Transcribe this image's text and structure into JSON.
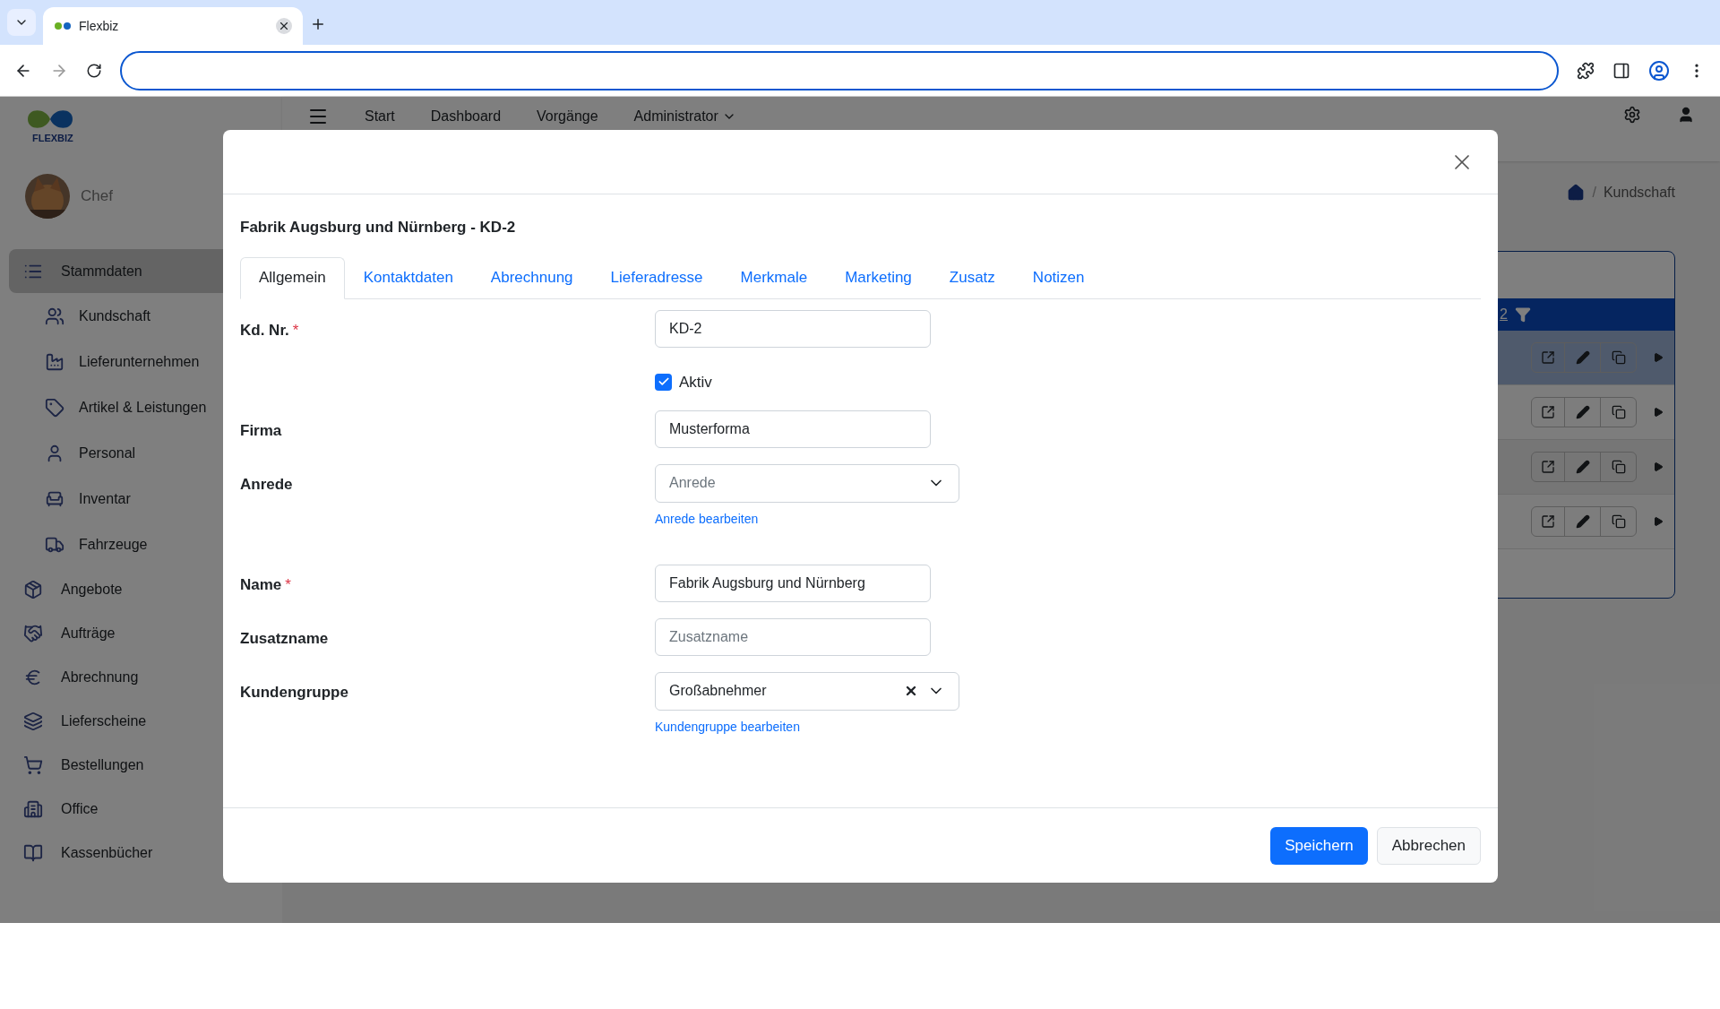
{
  "browser": {
    "tab_title": "Flexbiz"
  },
  "app": {
    "logo_text": "FLEXBIZ",
    "user": "Chef",
    "sidebar": [
      {
        "label": "Stammdaten",
        "selected": true,
        "children": [
          {
            "label": "Kundschaft"
          },
          {
            "label": "Lieferunternehmen"
          },
          {
            "label": "Artikel & Leistungen"
          },
          {
            "label": "Personal"
          },
          {
            "label": "Inventar"
          },
          {
            "label": "Fahrzeuge"
          }
        ]
      },
      {
        "label": "Angebote",
        "selected": false
      },
      {
        "label": "Aufträge",
        "selected": false
      },
      {
        "label": "Abrechnung",
        "selected": false
      },
      {
        "label": "Lieferscheine",
        "selected": false
      },
      {
        "label": "Bestellungen",
        "selected": false
      },
      {
        "label": "Office",
        "selected": false
      },
      {
        "label": "Kassenbücher",
        "selected": false
      }
    ],
    "nav": [
      {
        "label": "Start",
        "dropdown": false
      },
      {
        "label": "Dashboard",
        "dropdown": false
      },
      {
        "label": "Vorgänge",
        "dropdown": false
      },
      {
        "label": "Administrator",
        "dropdown": true
      }
    ],
    "breadcrumb": [
      {
        "separator": "/",
        "label": "Kundschaft"
      }
    ],
    "table": {
      "header_text": "2",
      "rows": [
        {
          "selected": true
        },
        {
          "selected": false
        },
        {
          "selected": false
        },
        {
          "selected": false
        }
      ]
    }
  },
  "modal": {
    "title": "Fabrik Augsburg und Nürnberg - KD-2",
    "tabs": [
      {
        "label": "Allgemein",
        "selected": true
      },
      {
        "label": "Kontaktdaten",
        "selected": false
      },
      {
        "label": "Abrechnung",
        "selected": false
      },
      {
        "label": "Lieferadresse",
        "selected": false
      },
      {
        "label": "Merkmale",
        "selected": false
      },
      {
        "label": "Marketing",
        "selected": false
      },
      {
        "label": "Zusatz",
        "selected": false
      },
      {
        "label": "Notizen",
        "selected": false
      }
    ],
    "fields": [
      {
        "kind": "text",
        "label": "Kd. Nr.",
        "required_mark": "*",
        "value": "KD-2"
      },
      {
        "kind": "checkbox",
        "label": "Aktiv",
        "checked": true
      },
      {
        "kind": "text",
        "label": "Firma",
        "value": "Musterforma"
      },
      {
        "kind": "select",
        "label": "Anrede",
        "placeholder": "Anrede",
        "clearable": false,
        "link": "Anrede bearbeiten"
      },
      {
        "kind": "text",
        "label": "Name",
        "required_mark": "*",
        "value": "Fabrik Augsburg und Nürnberg"
      },
      {
        "kind": "text",
        "label": "Zusatzname",
        "placeholder": "Zusatzname"
      },
      {
        "kind": "select",
        "label": "Kundengruppe",
        "value": "Großabnehmer",
        "clearable": true,
        "link": "Kundengruppe bearbeiten"
      }
    ],
    "buttons": [
      {
        "label": "Speichern",
        "kind": "primary"
      },
      {
        "label": "Abbrechen",
        "kind": "secondary"
      }
    ]
  }
}
